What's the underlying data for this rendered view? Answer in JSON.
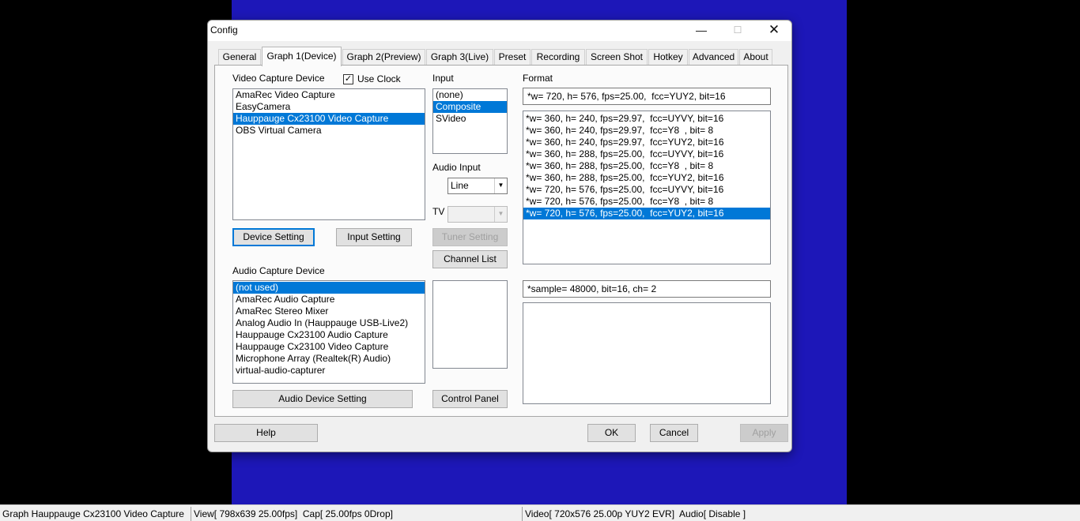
{
  "window": {
    "title": "Config",
    "minimize_glyph": "—",
    "maximize_glyph": "☐",
    "close_glyph": "✕"
  },
  "tabs": [
    {
      "label": "General"
    },
    {
      "label": "Graph 1(Device)"
    },
    {
      "label": "Graph 2(Preview)"
    },
    {
      "label": "Graph 3(Live)"
    },
    {
      "label": "Preset"
    },
    {
      "label": "Recording"
    },
    {
      "label": "Screen Shot"
    },
    {
      "label": "Hotkey"
    },
    {
      "label": "Advanced"
    },
    {
      "label": "About"
    }
  ],
  "active_tab": "Graph 1(Device)",
  "video": {
    "label": "Video Capture Device",
    "use_clock_label": "Use Clock",
    "use_clock_checked": true,
    "check_glyph": "✓",
    "devices": [
      "AmaRec Video Capture",
      "EasyCamera",
      "Hauppauge Cx23100 Video Capture",
      "OBS Virtual Camera"
    ],
    "selected_device": "Hauppauge Cx23100 Video Capture",
    "device_setting_label": "Device Setting",
    "input_setting_label": "Input Setting"
  },
  "input": {
    "label": "Input",
    "options": [
      "(none)",
      "Composite",
      "SVideo"
    ],
    "selected": "Composite",
    "audio_input_label": "Audio Input",
    "audio_input_value": "Line",
    "tv_label": "TV",
    "tv_value": "",
    "tuner_setting_label": "Tuner Setting",
    "channel_list_label": "Channel List",
    "control_panel_label": "Control Panel",
    "dropdown_arrow": "▼"
  },
  "format": {
    "label": "Format",
    "current": "*w= 720, h= 576, fps=25.00,  fcc=YUY2, bit=16",
    "options": [
      "*w= 360, h= 240, fps=29.97,  fcc=UYVY, bit=16",
      "*w= 360, h= 240, fps=29.97,  fcc=Y8  , bit= 8",
      "*w= 360, h= 240, fps=29.97,  fcc=YUY2, bit=16",
      "*w= 360, h= 288, fps=25.00,  fcc=UYVY, bit=16",
      "*w= 360, h= 288, fps=25.00,  fcc=Y8  , bit= 8",
      "*w= 360, h= 288, fps=25.00,  fcc=YUY2, bit=16",
      "*w= 720, h= 576, fps=25.00,  fcc=UYVY, bit=16",
      "*w= 720, h= 576, fps=25.00,  fcc=Y8  , bit= 8",
      "*w= 720, h= 576, fps=25.00,  fcc=YUY2, bit=16"
    ],
    "selected_index": 8,
    "audio_current": "*sample= 48000, bit=16, ch= 2"
  },
  "audio": {
    "label": "Audio Capture Device",
    "devices": [
      "(not used)",
      "AmaRec Audio Capture",
      "AmaRec Stereo Mixer",
      "Analog Audio In (Hauppauge USB-Live2)",
      "Hauppauge Cx23100 Audio Capture",
      "Hauppauge Cx23100 Video Capture",
      "Microphone Array (Realtek(R) Audio)",
      "virtual-audio-capturer"
    ],
    "selected": "(not used)",
    "audio_device_setting_label": "Audio Device Setting"
  },
  "footer": {
    "help_label": "Help",
    "ok_label": "OK",
    "cancel_label": "Cancel",
    "apply_label": "Apply"
  },
  "statusbar": {
    "graph": "Graph Hauppauge Cx23100 Video Capture",
    "view": "View[ 798x639 25.00fps]  Cap[ 25.00fps 0Drop]",
    "video": "Video[ 720x576 25.00p YUY2 EVR]  Audio[ Disable ]"
  },
  "colors": {
    "background_blue": "#1d17b8",
    "selection": "#0078d7"
  }
}
